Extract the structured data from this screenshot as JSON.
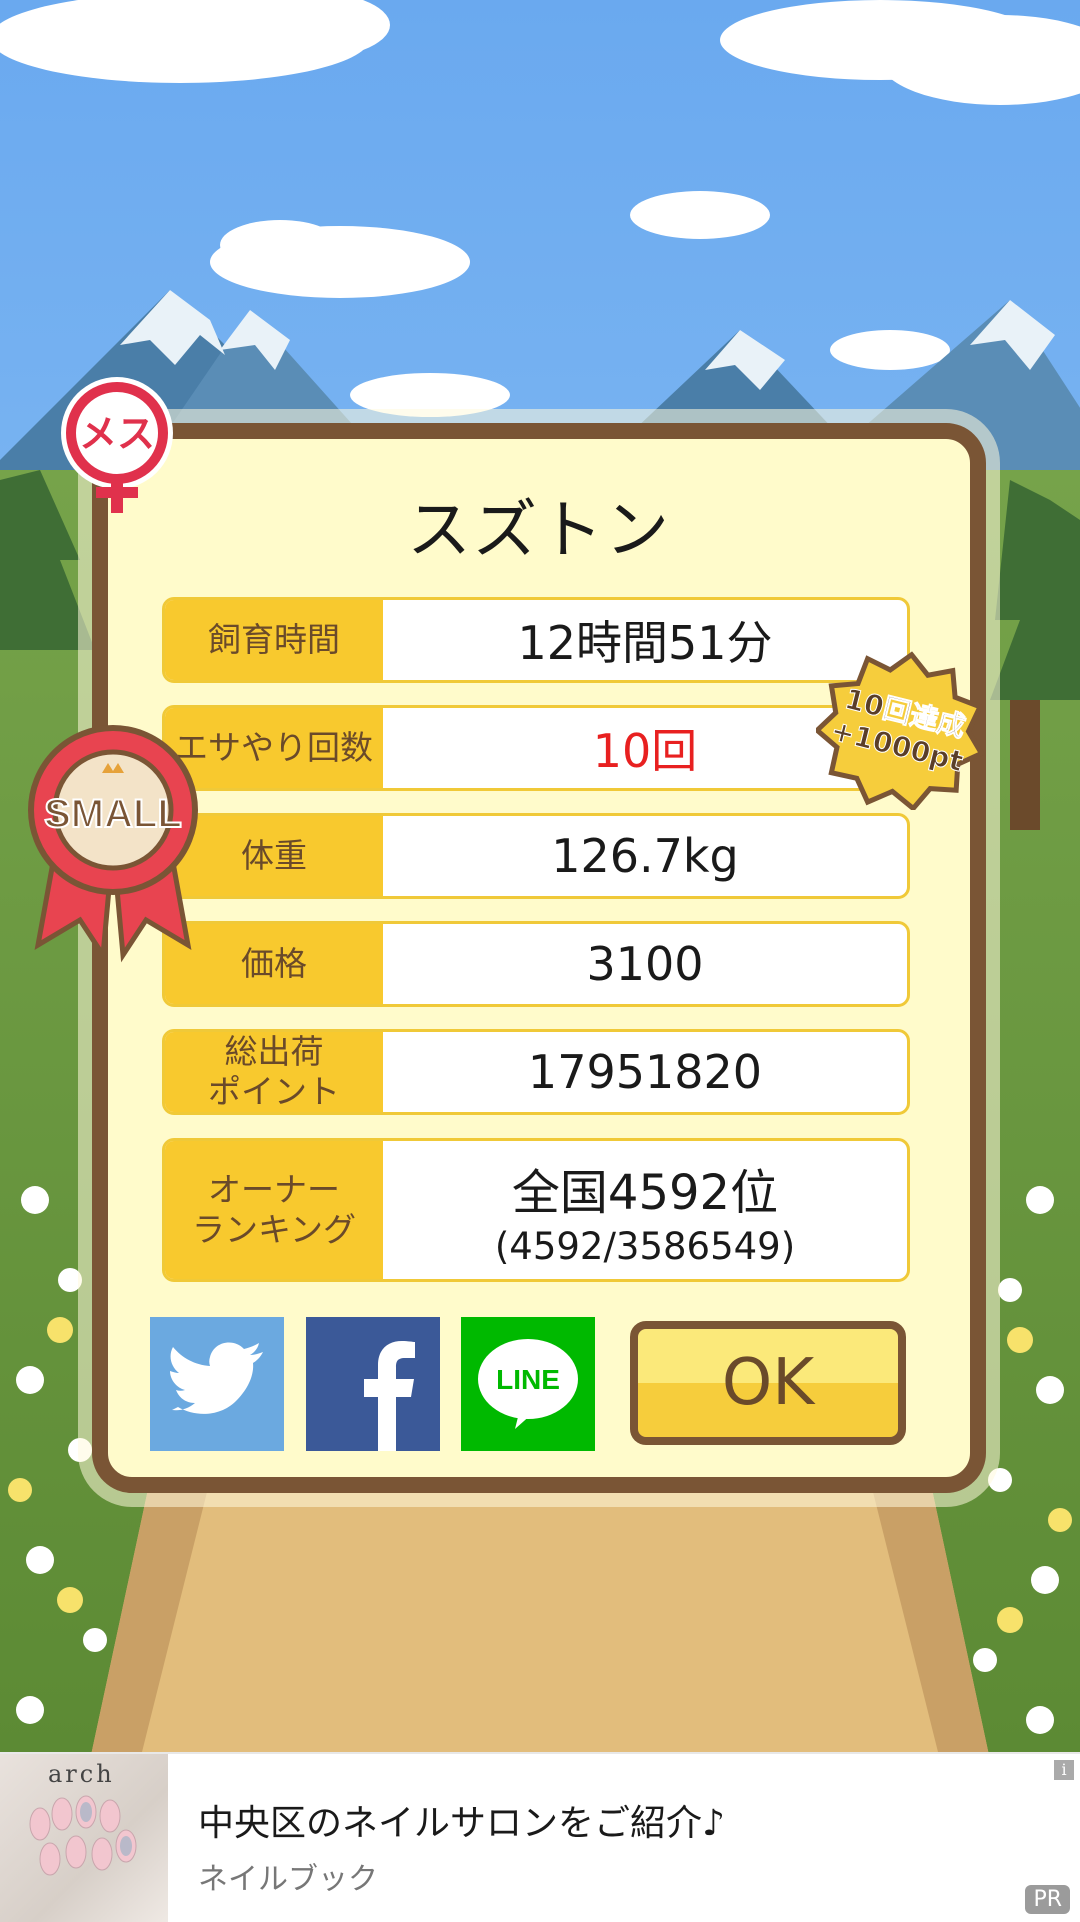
{
  "card": {
    "title": "スズトン",
    "rows": [
      {
        "label": "飼育時間",
        "value": "12時間51分"
      },
      {
        "label": "エサやり回数",
        "value": "10回"
      },
      {
        "label": "体重",
        "value": "126.7kg"
      },
      {
        "label": "価格",
        "value": "3100"
      },
      {
        "label_line1": "総出荷",
        "label_line2": "ポイント",
        "value": "17951820"
      },
      {
        "label_line1": "オーナー",
        "label_line2": "ランキング",
        "value": "全国4592位",
        "sub_value": "(4592/3586549)"
      }
    ],
    "ok_label": "OK"
  },
  "badges": {
    "gender": "メス",
    "size": "SMALL",
    "bonus_line1": "10回達成",
    "bonus_line2": "+1000pt"
  },
  "social": {
    "line_label": "LINE"
  },
  "ad": {
    "brand": "arch",
    "title": "中央区のネイルサロンをご紹介♪",
    "subtitle": "ネイルブック",
    "info": "i",
    "pr": "PR"
  },
  "colors": {
    "label_bg": "#f8c92e",
    "frame": "#7a5535",
    "card_bg": "#fffbcb",
    "highlight_red": "#e82020"
  }
}
